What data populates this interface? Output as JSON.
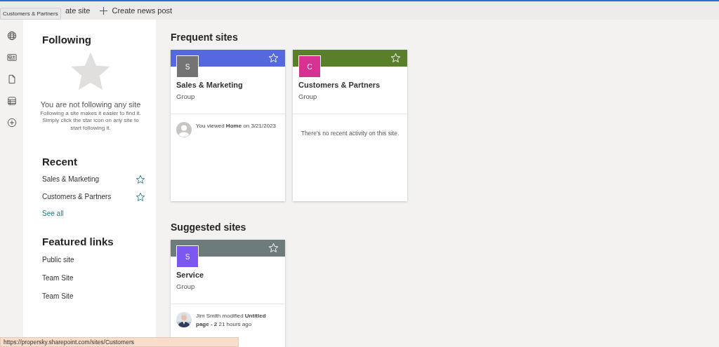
{
  "toolbar": {
    "items": [
      {
        "label": "ate site",
        "kind": "plain"
      },
      {
        "label": "Create news post",
        "kind": "add"
      }
    ],
    "tooltip": "Customers & Partners"
  },
  "following": {
    "title": "Following",
    "empty_title": "You are not following any site",
    "empty_text": "Following a site makes it easier to find it. Simply click the star icon on any site to start following it."
  },
  "recent": {
    "title": "Recent",
    "items": [
      "Sales & Marketing",
      "Customers & Partners"
    ],
    "see_all": "See all"
  },
  "featured": {
    "title": "Featured links",
    "items": [
      "Public site",
      "Team Site",
      "Team Site"
    ]
  },
  "sections": [
    {
      "title": "Frequent sites",
      "cards": [
        {
          "color": "#5568e0",
          "logo": {
            "color": "#737373",
            "initial": "S"
          },
          "title": "Sales & Marketing",
          "subtitle": "Group",
          "activity": {
            "kind": "user",
            "text": "You viewed **Home** on 3/21/2023"
          }
        },
        {
          "color": "#5a7f2b",
          "logo": {
            "color": "#d63193",
            "initial": "C"
          },
          "title": "Customers & Partners",
          "subtitle": "Group",
          "activity": {
            "kind": "none",
            "text": "There's no recent activity on this site."
          }
        }
      ]
    },
    {
      "title": "Suggested sites",
      "cards": [
        {
          "color": "#6d7b7a",
          "logo": {
            "color": "#7b56f0",
            "initial": "S"
          },
          "title": "Service",
          "subtitle": "Group",
          "activity": {
            "text": "Jim Smith modified **Untitled page - 2** 21 hours ago"
          }
        }
      ]
    }
  ],
  "status_url": "https://propersky.sharepoint.com/sites/Customers"
}
